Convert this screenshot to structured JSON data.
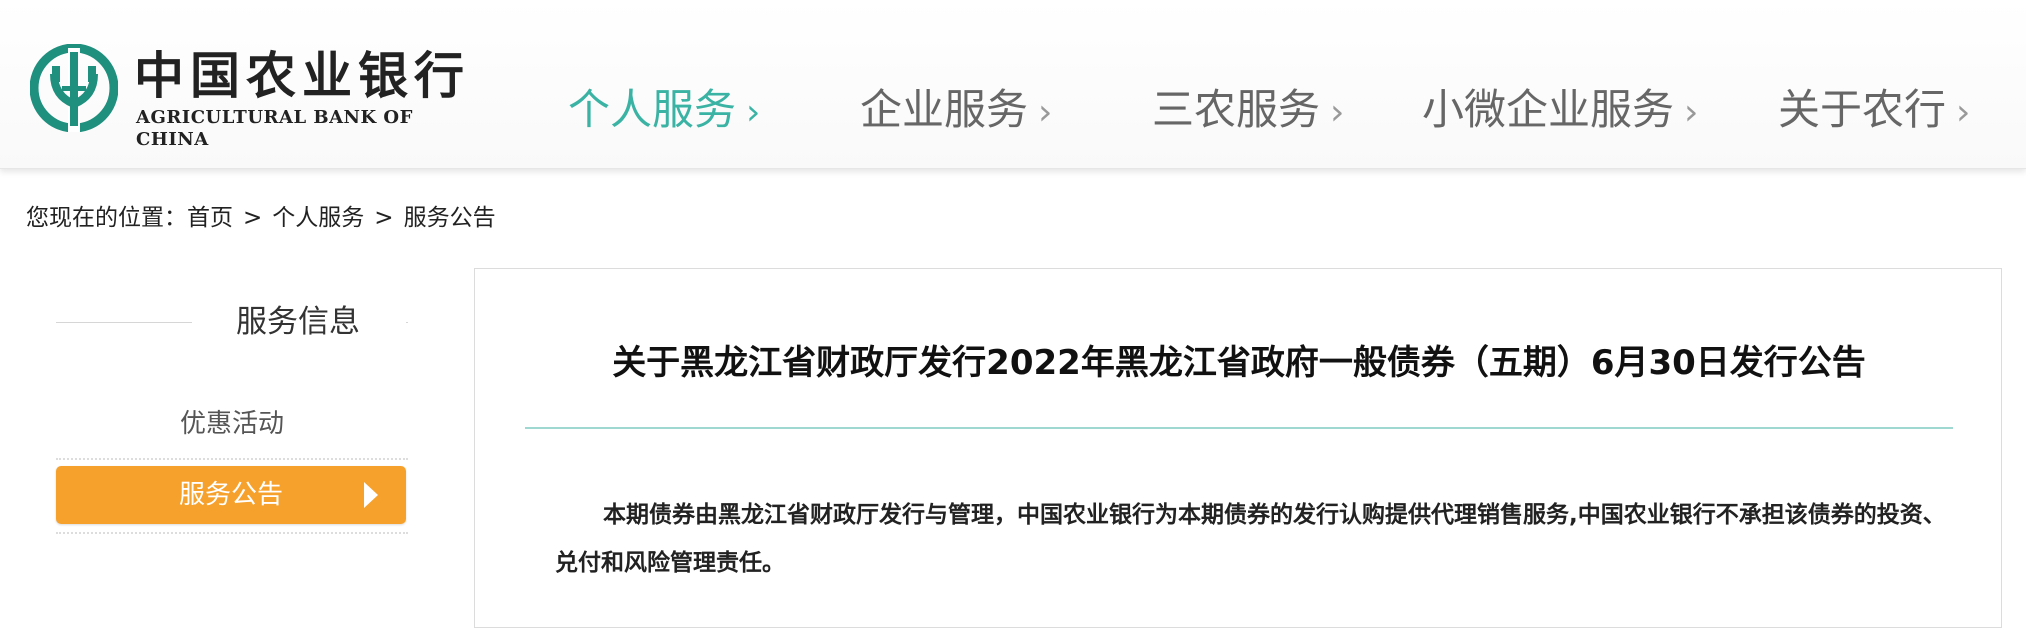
{
  "brand": {
    "name_cn": "中国农业银行",
    "name_en": "AGRICULTURAL BANK OF CHINA",
    "color": "#1f8f7e"
  },
  "nav": {
    "items": [
      {
        "label": "个人服务",
        "active": true
      },
      {
        "label": "企业服务",
        "active": false
      },
      {
        "label": "三农服务",
        "active": false
      },
      {
        "label": "小微企业服务",
        "active": false
      },
      {
        "label": "关于农行",
        "active": false
      }
    ],
    "chevron": "›",
    "active_color": "#3bb3a4"
  },
  "breadcrumb": {
    "prefix": "您现在的位置：",
    "items": [
      "首页",
      "个人服务",
      "服务公告"
    ],
    "separator": ">"
  },
  "sidebar": {
    "title": "服务信息",
    "items": [
      {
        "label": "优惠活动",
        "active": false
      },
      {
        "label": "服务公告",
        "active": true
      }
    ],
    "active_color": "#f7a12d"
  },
  "article": {
    "title": "关于黑龙江省财政厅发行2022年黑龙江省政府一般债券（五期）6月30日发行公告",
    "body": "本期债券由黑龙江省财政厅发行与管理，中国农业银行为本期债券的发行认购提供代理销售服务,中国农业银行不承担该债券的投资、兑付和风险管理责任。"
  }
}
